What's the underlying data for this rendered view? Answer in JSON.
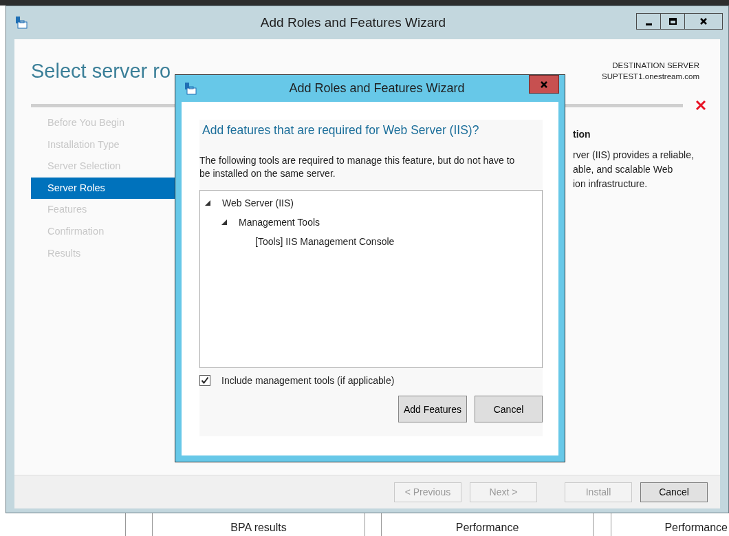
{
  "window": {
    "title": "Add Roles and Features Wizard"
  },
  "page_title": "Select server ro",
  "destination": {
    "label": "DESTINATION SERVER",
    "server": "SUPTEST1.onestream.com"
  },
  "steps": [
    {
      "label": "Before You Begin",
      "selected": false
    },
    {
      "label": "Installation Type",
      "selected": false
    },
    {
      "label": "Server Selection",
      "selected": false
    },
    {
      "label": "Server Roles",
      "selected": true
    },
    {
      "label": "Features",
      "selected": false
    },
    {
      "label": "Confirmation",
      "selected": false
    },
    {
      "label": "Results",
      "selected": false
    }
  ],
  "description": {
    "heading": "tion",
    "lines": [
      "rver (IIS) provides a reliable,",
      "able, and scalable Web",
      "ion infrastructure."
    ]
  },
  "footer_buttons": [
    {
      "label": "< Previous",
      "disabled": true
    },
    {
      "label": "Next >",
      "disabled": true
    },
    {
      "label": "Install",
      "disabled": true
    },
    {
      "label": "Cancel",
      "disabled": false
    }
  ],
  "dialog": {
    "title": "Add Roles and Features Wizard",
    "heading": "Add features that are required for Web Server (IIS)?",
    "message": "The following tools are required to manage this feature, but do not have to be installed on the same server.",
    "tree": [
      {
        "label": "Web Server (IIS)",
        "expanded": true,
        "children": [
          {
            "label": "Management Tools",
            "expanded": true,
            "children": [
              {
                "label": "[Tools] IIS Management Console"
              }
            ]
          }
        ]
      }
    ],
    "checkbox": {
      "label": "Include management tools (if applicable)",
      "checked": true
    },
    "buttons": [
      "Add Features",
      "Cancel"
    ]
  },
  "background_table": {
    "cells": [
      "BPA results",
      "Performance",
      "Performance"
    ]
  }
}
